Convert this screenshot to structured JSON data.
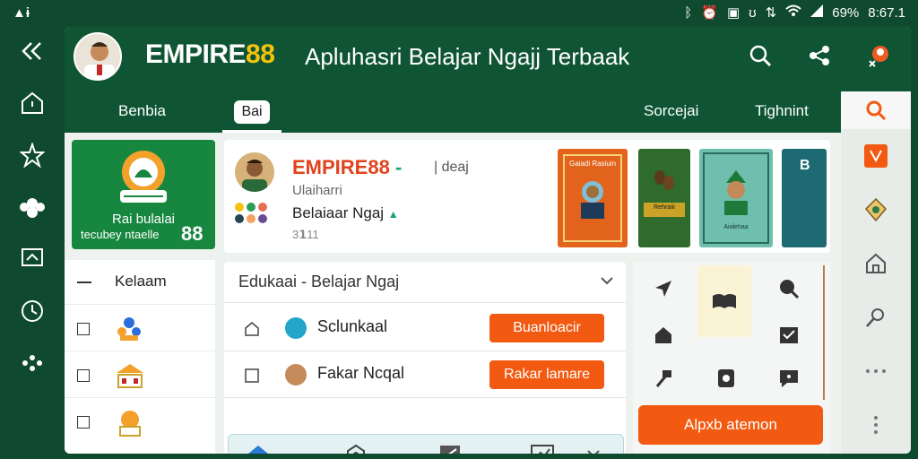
{
  "status_bar": {
    "left_glyph": "▲ɨ",
    "time": "8:67.1",
    "battery": "69%"
  },
  "header": {
    "brand_prefix": "EMPIRE",
    "brand_num": "88",
    "title": "Apluhasri Belajar Ngajj Terbaak"
  },
  "tabs": [
    {
      "label": "Benbia"
    },
    {
      "label": "Bai"
    },
    {
      "label": "Sorcejai"
    },
    {
      "label": "Tighnint"
    }
  ],
  "promo": {
    "line1": "Rai bulalai",
    "line2": "tecubey ntaelle",
    "num": "88"
  },
  "profile": {
    "name": "EMPIRE88",
    "sep": "-",
    "sub": "|  deaj",
    "line1": "Ulaiharri",
    "line2": "Belaiaar Ngaj",
    "line3": "3𝟭11"
  },
  "books": [
    {
      "title": "Gaiadi Rasiuin",
      "color": "#e2631b"
    },
    {
      "title": "Rehraiii",
      "color": "#2f6b2c"
    },
    {
      "title": "Aialehaa",
      "color": "#6fbfae"
    },
    {
      "title": "B",
      "color": "#1d6a72"
    }
  ],
  "menu": {
    "header": "Kelaam"
  },
  "content": {
    "title": "Edukaai - Belajar Ngaj",
    "rows": [
      {
        "label": "Sclunkaal",
        "button": "Buanloacir"
      },
      {
        "label": "Fakar Ncqal",
        "button": "Rakar lamare"
      }
    ]
  },
  "action_button": "Alpxb atemon",
  "colors": {
    "primary_green": "#0f5533",
    "accent_orange": "#f25a12",
    "brand_yellow": "#f4c20d"
  }
}
